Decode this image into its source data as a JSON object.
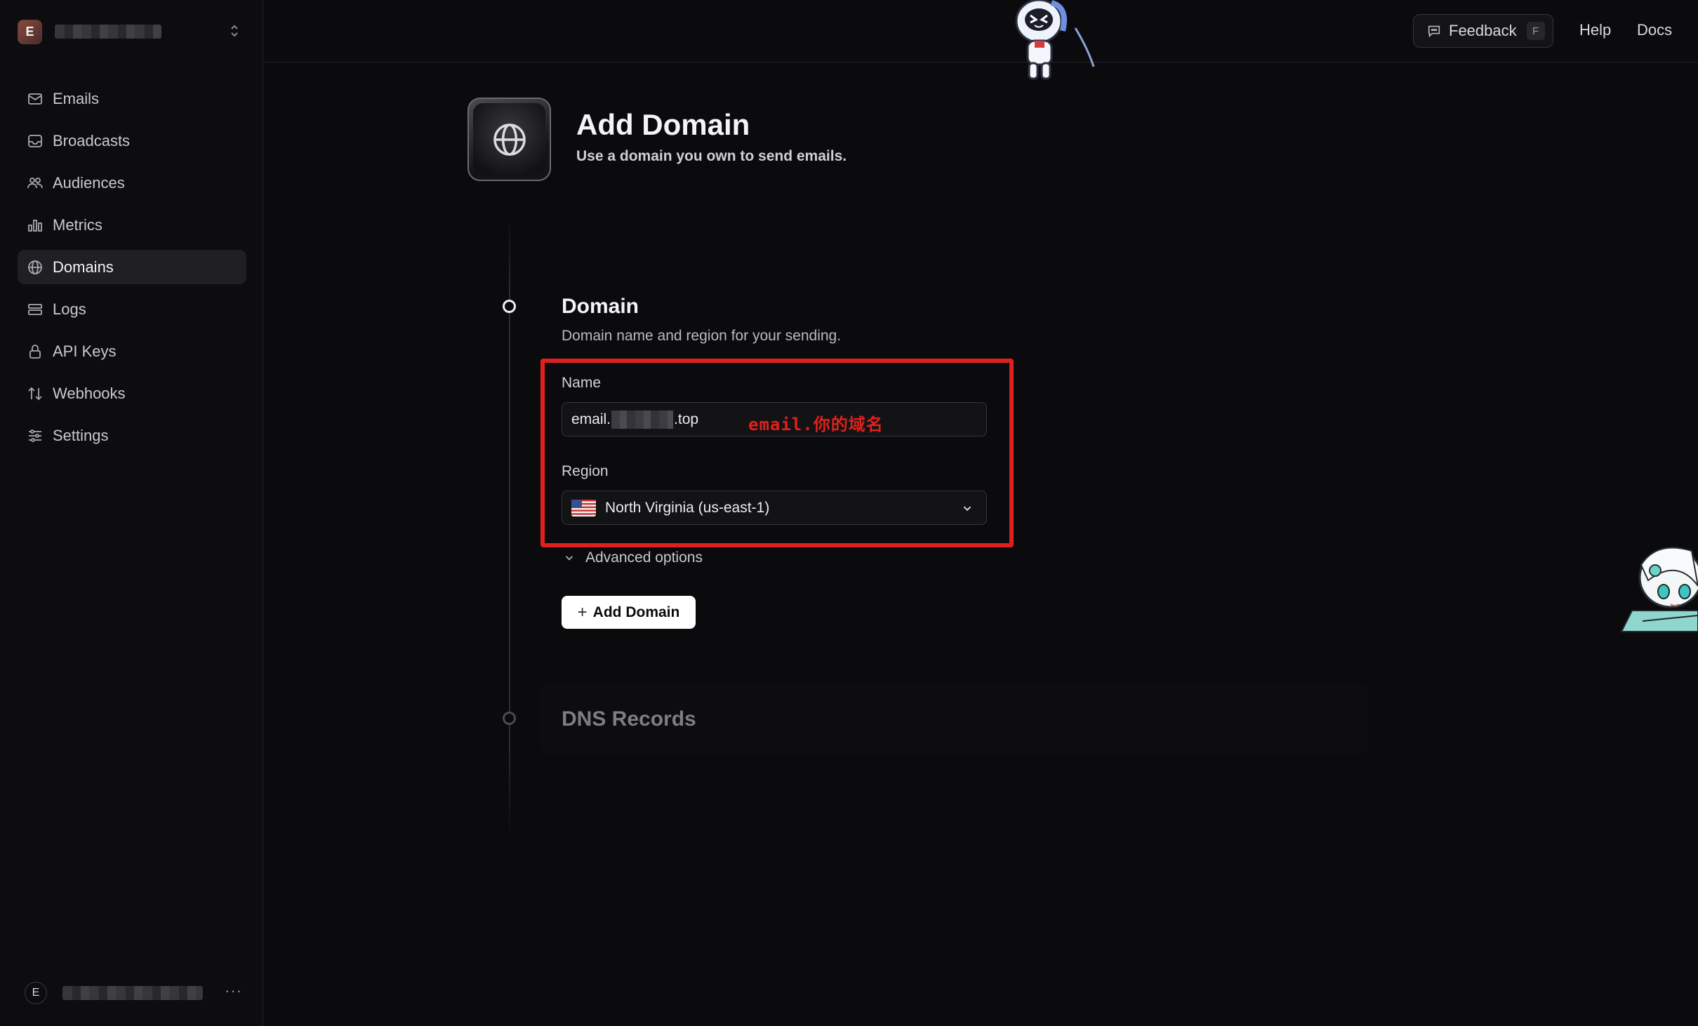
{
  "sidebar": {
    "workspace": {
      "avatar_letter": "E"
    },
    "items": [
      {
        "label": "Emails",
        "icon": "mail-icon"
      },
      {
        "label": "Broadcasts",
        "icon": "inbox-icon"
      },
      {
        "label": "Audiences",
        "icon": "users-icon"
      },
      {
        "label": "Metrics",
        "icon": "bar-chart-icon"
      },
      {
        "label": "Domains",
        "icon": "globe-icon",
        "active": true
      },
      {
        "label": "Logs",
        "icon": "logs-icon"
      },
      {
        "label": "API Keys",
        "icon": "lock-icon"
      },
      {
        "label": "Webhooks",
        "icon": "arrows-icon"
      },
      {
        "label": "Settings",
        "icon": "sliders-icon"
      }
    ],
    "user": {
      "avatar_letter": "E",
      "more": "···"
    }
  },
  "topbar": {
    "feedback_label": "Feedback",
    "feedback_shortcut": "F",
    "help_label": "Help",
    "docs_label": "Docs"
  },
  "header": {
    "title": "Add Domain",
    "subtitle": "Use a domain you own to send emails."
  },
  "domain_step": {
    "title": "Domain",
    "description": "Domain name and region for your sending.",
    "name_label": "Name",
    "name_value_prefix": "email.",
    "name_value_suffix": ".top",
    "region_label": "Region",
    "region_value": "North Virginia (us-east-1)",
    "advanced_label": "Advanced options",
    "add_button_label": "Add Domain"
  },
  "annotation": {
    "text": "email.你的域名",
    "color": "#e0201a"
  },
  "dns_step": {
    "title": "DNS Records"
  },
  "colors": {
    "background": "#0b0b0e",
    "accent": "#ffffff",
    "highlight": "#e0201a"
  }
}
